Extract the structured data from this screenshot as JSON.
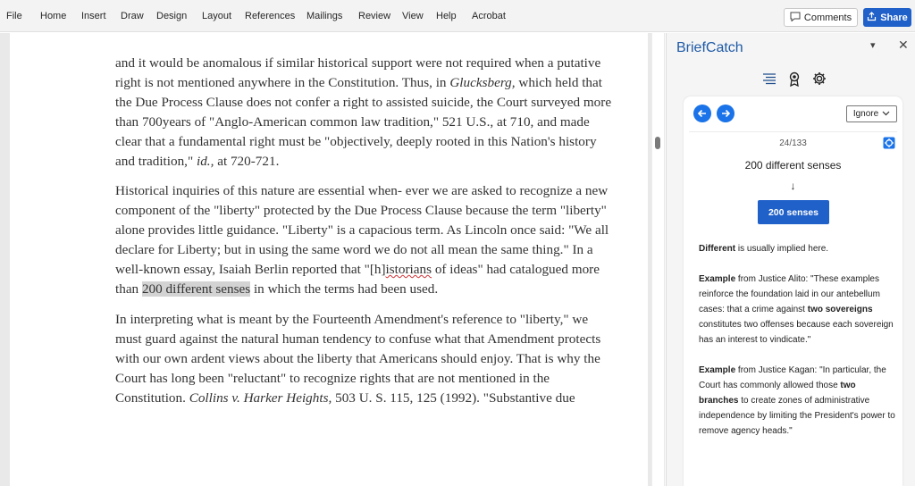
{
  "ribbon": {
    "tabs": [
      "File",
      "Home",
      "Insert",
      "Draw",
      "Design",
      "Layout",
      "References",
      "Mailings",
      "Review",
      "View",
      "Help",
      "Acrobat"
    ],
    "comments_label": "Comments",
    "share_label": "Share"
  },
  "document": {
    "p1": {
      "t1": "and it would be anomalous if similar historical support were not required when a putative right is not mentioned anywhere in the Constitution.  Thus, in ",
      "i1": "Glucksberg,",
      "t2": " which held that the Due Process Clause does not confer a right to assisted suicide, the  Court surveyed more than 700years of \"Anglo-American common law tradition,\" 521 U.S., at 710, and  made clear that a fundamental right must be \"objectively, deeply rooted in this Nation's history and tradition,\" ",
      "i2": "id.,",
      "t3": " at  720-721."
    },
    "p2": {
      "t1": "Historical inquiries of this nature are essential when- ever we are asked to recognize a new component of the \"liberty\" protected by the Due Process Clause because the term \"liberty\" alone provides little guidance.  \"Liberty\" is a capacious term.  As Lincoln once said:  \"We all declare for Liberty; but in using the same word we do not all mean the same thing.\"  In a well-known essay, Isaiah Berlin reported that \"[h]",
      "squig": "istorians",
      "t2": " of ideas\" had catalogued more than ",
      "highlight": "200 different senses",
      "t3": " in which the terms had been used."
    },
    "p3": {
      "t1": "In interpreting what is meant by the  Fourteenth Amendment's reference to \"liberty,\" we must guard against the natural human tendency to confuse what that Amendment protects with our own ardent views about the liberty that Americans should enjoy.  That is why the Court has long been \"reluctant\" to recognize rights that are not mentioned in the Constitution. ",
      "i1": "Collins v. Harker Heights,",
      "t2": " 503 U. S. 115, 125 (1992). \"Substantive due"
    }
  },
  "pane": {
    "title": "BriefCatch",
    "menu_glyph": "▾",
    "close_glyph": "✕",
    "ignore_label": "Ignore",
    "counter": "24/133",
    "original": "200 different senses",
    "arrow": "↓",
    "suggestion": "200 senses",
    "explanation": {
      "e1_bold": "Different",
      "e1_rest": " is usually implied here.",
      "e2_label": "Example",
      "e2_a": " from Justice Alito: \"These examples reinforce the foundation laid in our antebellum cases: that a crime against ",
      "e2_bold": "two sovereigns",
      "e2_b": " constitutes two offenses because each sovereign has an interest to vindicate.\"",
      "e3_label": "Example",
      "e3_a": " from Justice Kagan: \"In particular, the Court has commonly allowed those ",
      "e3_bold": "two branches",
      "e3_b": " to create zones of administrative independence by limiting the President's power to remove agency heads.\""
    }
  },
  "icons": {
    "comments": "comment-icon",
    "share": "share-icon",
    "pane_tabs": [
      "list-icon",
      "award-icon",
      "gear-icon"
    ],
    "nav": [
      "arrow-left-icon",
      "arrow-right-icon"
    ],
    "expand": "expand-icon"
  },
  "colors": {
    "accent": "#1f60c9",
    "title": "#1f5aa6",
    "highlight": "#d3d3d3"
  }
}
